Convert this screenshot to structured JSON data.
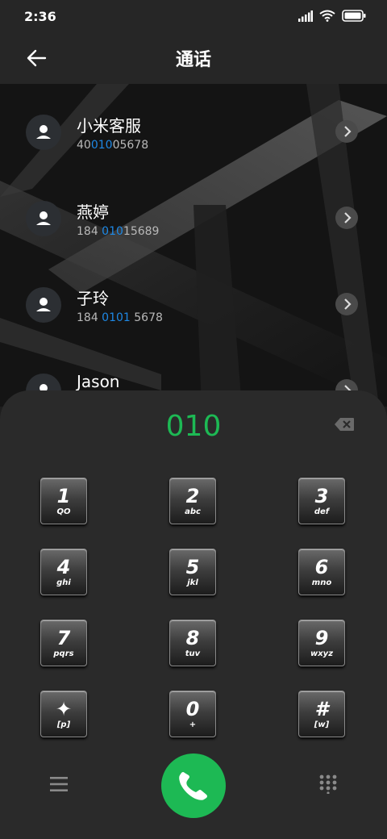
{
  "status": {
    "time": "2:36"
  },
  "header": {
    "title": "通话"
  },
  "contacts": [
    {
      "name": "小米客服",
      "num_pre": "40",
      "num_hl": "010",
      "num_post": "05678"
    },
    {
      "name": "燕婷",
      "num_pre": "184 ",
      "num_hl": "010",
      "num_post": "15689"
    },
    {
      "name": "子玲",
      "num_pre": "184 ",
      "num_hl": "0101",
      "num_post": " 5678"
    },
    {
      "name": "Jason",
      "num_pre": "",
      "num_hl": "",
      "num_post": ""
    }
  ],
  "dialer": {
    "input": "010",
    "keys": [
      {
        "num": "1",
        "sub": "QO"
      },
      {
        "num": "2",
        "sub": "abc"
      },
      {
        "num": "3",
        "sub": "def"
      },
      {
        "num": "4",
        "sub": "ghi"
      },
      {
        "num": "5",
        "sub": "jkl"
      },
      {
        "num": "6",
        "sub": "mno"
      },
      {
        "num": "7",
        "sub": "pqrs"
      },
      {
        "num": "8",
        "sub": "tuv"
      },
      {
        "num": "9",
        "sub": "wxyz"
      },
      {
        "num": "✦",
        "sub": "[p]"
      },
      {
        "num": "0",
        "sub": "+"
      },
      {
        "num": "#",
        "sub": "[w]"
      }
    ]
  },
  "icons": {
    "back": "arrow-left-icon",
    "backspace": "backspace-icon",
    "menu": "menu-icon",
    "call": "phone-icon",
    "dialpad": "dialpad-icon"
  },
  "colors": {
    "accent_green": "#1db954",
    "match_blue": "#1e88e5"
  }
}
